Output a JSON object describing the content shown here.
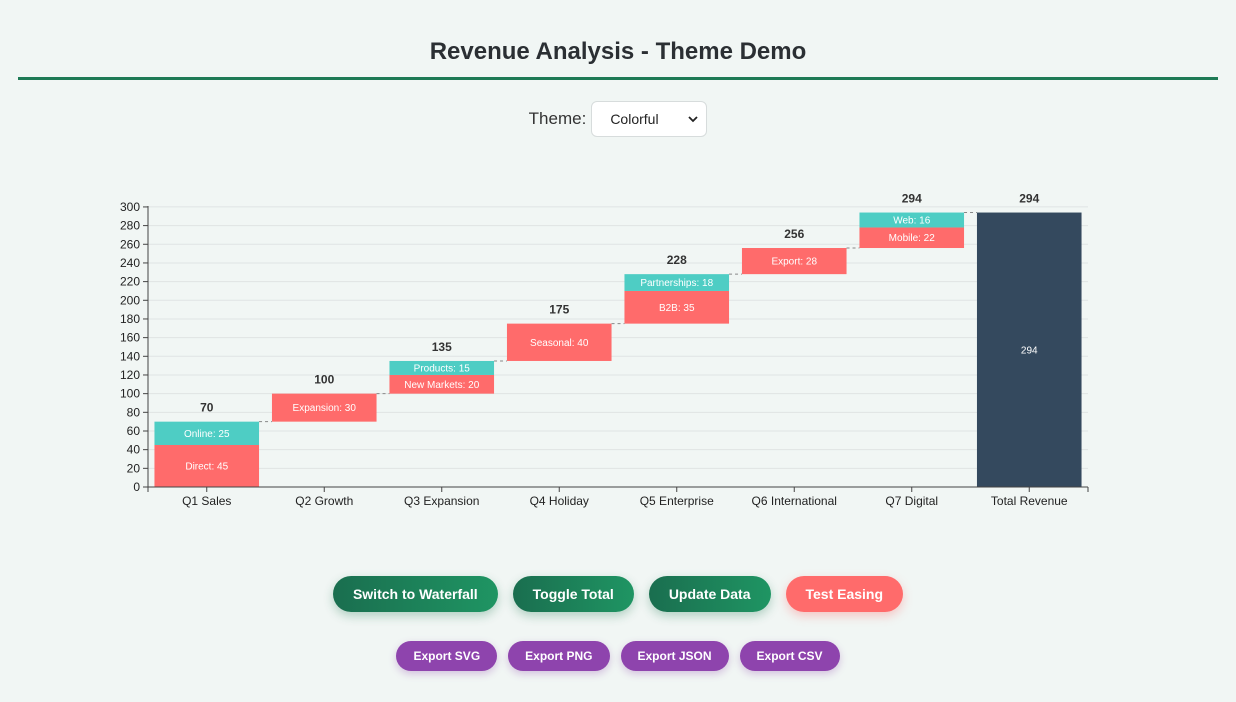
{
  "page": {
    "title": "Revenue Analysis - Theme Demo"
  },
  "theme": {
    "label": "Theme:",
    "selected": "Colorful"
  },
  "colors": {
    "accent": "#1e7a55",
    "positive_primary": "#ff6b6b",
    "positive_secondary": "#4ecdc4",
    "total": "#34495e",
    "export": "#8e44ad"
  },
  "chart_data": {
    "type": "bar",
    "subtype": "stacked-waterfall",
    "categories": [
      "Q1 Sales",
      "Q2 Growth",
      "Q3 Expansion",
      "Q4 Holiday",
      "Q5 Enterprise",
      "Q6 International",
      "Q7 Digital",
      "Total Revenue"
    ],
    "bars": [
      {
        "category": "Q1 Sales",
        "start": 0,
        "end": 70,
        "label": "70",
        "segments": [
          {
            "label": "Direct: 45",
            "value": 45,
            "color": "#ff6b6b"
          },
          {
            "label": "Online: 25",
            "value": 25,
            "color": "#4ecdc4"
          }
        ]
      },
      {
        "category": "Q2 Growth",
        "start": 70,
        "end": 100,
        "label": "100",
        "segments": [
          {
            "label": "Expansion: 30",
            "value": 30,
            "color": "#ff6b6b"
          }
        ]
      },
      {
        "category": "Q3 Expansion",
        "start": 100,
        "end": 135,
        "label": "135",
        "segments": [
          {
            "label": "New Markets: 20",
            "value": 20,
            "color": "#ff6b6b"
          },
          {
            "label": "Products: 15",
            "value": 15,
            "color": "#4ecdc4"
          }
        ]
      },
      {
        "category": "Q4 Holiday",
        "start": 135,
        "end": 175,
        "label": "175",
        "segments": [
          {
            "label": "Seasonal: 40",
            "value": 40,
            "color": "#ff6b6b"
          }
        ]
      },
      {
        "category": "Q5 Enterprise",
        "start": 175,
        "end": 228,
        "label": "228",
        "segments": [
          {
            "label": "B2B: 35",
            "value": 35,
            "color": "#ff6b6b"
          },
          {
            "label": "Partnerships: 18",
            "value": 18,
            "color": "#4ecdc4"
          }
        ]
      },
      {
        "category": "Q6 International",
        "start": 228,
        "end": 256,
        "label": "256",
        "segments": [
          {
            "label": "Export: 28",
            "value": 28,
            "color": "#ff6b6b"
          }
        ]
      },
      {
        "category": "Q7 Digital",
        "start": 256,
        "end": 294,
        "label": "294",
        "segments": [
          {
            "label": "Mobile: 22",
            "value": 22,
            "color": "#ff6b6b"
          },
          {
            "label": "Web: 16",
            "value": 16,
            "color": "#4ecdc4"
          }
        ]
      },
      {
        "category": "Total Revenue",
        "start": 0,
        "end": 294,
        "label": "294",
        "is_total": true,
        "segments": [
          {
            "label": "294",
            "value": 294,
            "color": "#34495e"
          }
        ]
      }
    ],
    "y_ticks": [
      0,
      20,
      40,
      60,
      80,
      100,
      120,
      140,
      160,
      180,
      200,
      220,
      240,
      260,
      280,
      300
    ],
    "ylim": [
      0,
      301
    ],
    "grid": true,
    "connectors": "dashed"
  },
  "buttons": {
    "primary": [
      {
        "label": "Switch to Waterfall",
        "name": "switch-to-waterfall-button"
      },
      {
        "label": "Toggle Total",
        "name": "toggle-total-button"
      },
      {
        "label": "Update Data",
        "name": "update-data-button"
      },
      {
        "label": "Test Easing",
        "name": "test-easing-button"
      }
    ],
    "export": [
      {
        "label": "Export SVG",
        "name": "export-svg-button"
      },
      {
        "label": "Export PNG",
        "name": "export-png-button"
      },
      {
        "label": "Export JSON",
        "name": "export-json-button"
      },
      {
        "label": "Export CSV",
        "name": "export-csv-button"
      }
    ]
  }
}
